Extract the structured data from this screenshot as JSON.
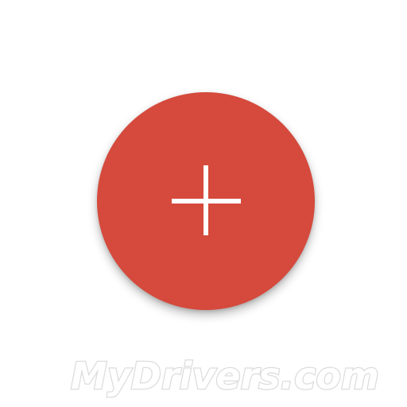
{
  "colors": {
    "background": "#ffffff",
    "fab": "#d54a3c",
    "icon": "#ffffff",
    "watermark_fill": "#ffffff",
    "watermark_stroke": "#dcdcdc"
  },
  "fab": {
    "icon": "plus-icon"
  },
  "watermark": {
    "text": "MyDrivers.com"
  }
}
